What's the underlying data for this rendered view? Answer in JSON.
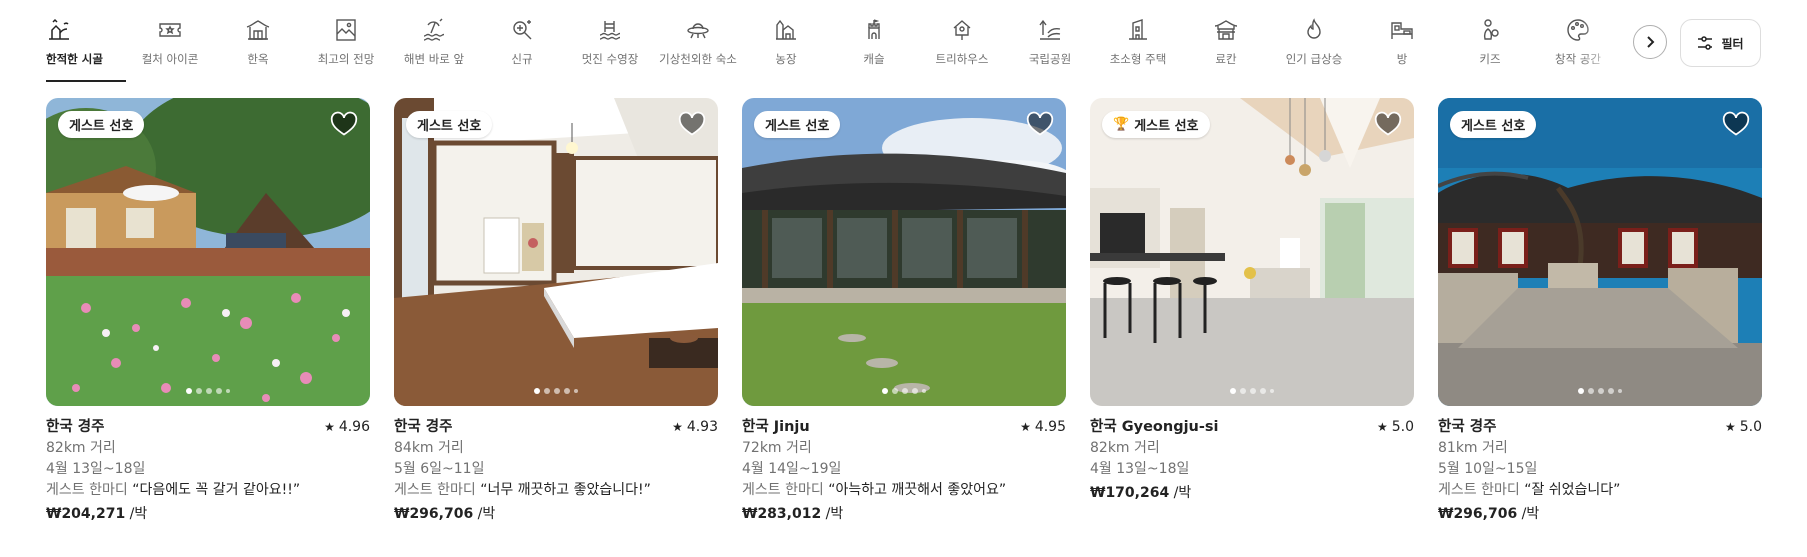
{
  "categories": [
    {
      "label": "한적한 시골",
      "icon": "countryside-icon",
      "active": true
    },
    {
      "label": "컬처 아이콘",
      "icon": "ticket-star-icon",
      "active": false
    },
    {
      "label": "한옥",
      "icon": "hanok-icon",
      "active": false
    },
    {
      "label": "최고의 전망",
      "icon": "framed-view-icon",
      "active": false
    },
    {
      "label": "해변 바로 앞",
      "icon": "beachfront-icon",
      "active": false
    },
    {
      "label": "신규",
      "icon": "new-sparkle-icon",
      "active": false
    },
    {
      "label": "멋진 수영장",
      "icon": "pool-icon",
      "active": false
    },
    {
      "label": "기상천외한 숙소",
      "icon": "ufo-icon",
      "active": false
    },
    {
      "label": "농장",
      "icon": "farm-icon",
      "active": false
    },
    {
      "label": "캐슬",
      "icon": "castle-icon",
      "active": false
    },
    {
      "label": "트리하우스",
      "icon": "treehouse-icon",
      "active": false
    },
    {
      "label": "국립공원",
      "icon": "national-park-icon",
      "active": false
    },
    {
      "label": "초소형 주택",
      "icon": "tiny-home-icon",
      "active": false
    },
    {
      "label": "료칸",
      "icon": "ryokan-icon",
      "active": false
    },
    {
      "label": "인기 급상승",
      "icon": "trending-flame-icon",
      "active": false
    },
    {
      "label": "방",
      "icon": "room-icon",
      "active": false
    },
    {
      "label": "키즈",
      "icon": "kids-icon",
      "active": false
    },
    {
      "label": "창작 공간",
      "icon": "creative-space-icon",
      "active": false
    }
  ],
  "filter": {
    "label": "필터",
    "icon": "filter-sliders-icon"
  },
  "listings": [
    {
      "badge": "게스트 선호",
      "trophy": false,
      "location": "한국 경주",
      "rating": "4.96",
      "distance": "82km 거리",
      "dates": "4월 13일~18일",
      "review_label": "게스트 한마디",
      "review": "“다음에도 꼭 갈거 같아요!!”",
      "price": "₩204,271",
      "per": " /박"
    },
    {
      "badge": "게스트 선호",
      "trophy": false,
      "location": "한국 경주",
      "rating": "4.93",
      "distance": "84km 거리",
      "dates": "5월 6일~11일",
      "review_label": "게스트 한마디",
      "review": "“너무 깨끗하고 좋았습니다!”",
      "price": "₩296,706",
      "per": " /박"
    },
    {
      "badge": "게스트 선호",
      "trophy": false,
      "location": "한국 Jinju",
      "rating": "4.95",
      "distance": "72km 거리",
      "dates": "4월 14일~19일",
      "review_label": "게스트 한마디",
      "review": "“아늑하고 깨끗해서 좋았어요”",
      "price": "₩283,012",
      "per": " /박"
    },
    {
      "badge": "게스트 선호",
      "trophy": true,
      "location": "한국 Gyeongju-si",
      "rating": "5.0",
      "distance": "82km 거리",
      "dates": "4월 13일~18일",
      "review_label": "",
      "review": "",
      "price": "₩170,264",
      "per": " /박"
    },
    {
      "badge": "게스트 선호",
      "trophy": false,
      "location": "한국 경주",
      "rating": "5.0",
      "distance": "81km 거리",
      "dates": "5월 10일~15일",
      "review_label": "게스트 한마디",
      "review": "“잘 쉬었습니다”",
      "price": "₩296,706",
      "per": " /박"
    }
  ]
}
